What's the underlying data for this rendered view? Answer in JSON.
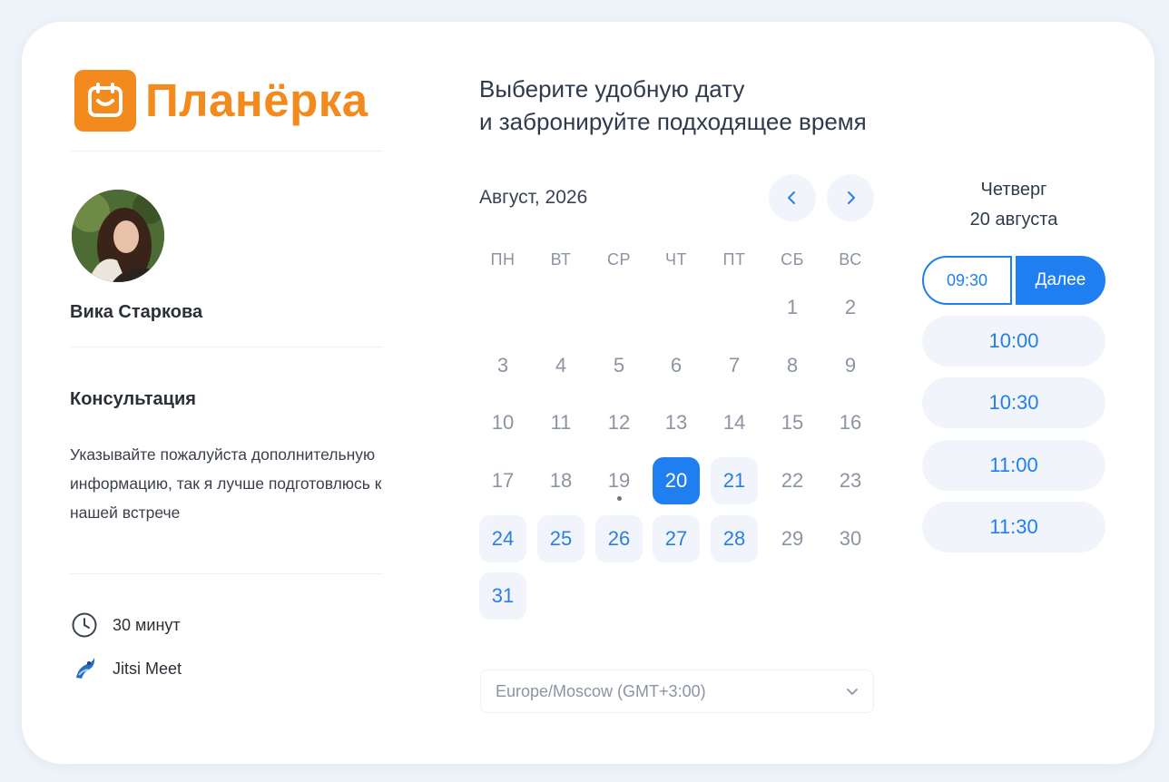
{
  "brand": {
    "name": "Планёрка",
    "color": "#f28a1d"
  },
  "host": {
    "name": "Вика Старкова"
  },
  "event": {
    "title": "Консультация",
    "description": "Указывайте пожалуйста дополнительную информацию, так я лучше подготовлюсь к нашей встрече",
    "duration": "30 минут",
    "location": "Jitsi Meet"
  },
  "heading": {
    "line1": "Выберите удобную дату",
    "line2": "и забронируйте подходящее время"
  },
  "calendar": {
    "month_label": "Август, 2026",
    "weekdays": [
      "ПН",
      "ВТ",
      "СР",
      "ЧТ",
      "ПТ",
      "СБ",
      "ВС"
    ],
    "first_weekday_index": 5,
    "days_in_month": 31,
    "today": 19,
    "selected": 20,
    "available": [
      20,
      21,
      24,
      25,
      26,
      27,
      28,
      31
    ]
  },
  "timezone": {
    "value": "Europe/Moscow (GMT+3:00)"
  },
  "slots": {
    "day_name": "Четверг",
    "day_date": "20 августа",
    "selected_time": "09:30",
    "next_label": "Далее",
    "times": [
      "10:00",
      "10:30",
      "11:00",
      "11:30"
    ]
  },
  "colors": {
    "accent": "#1f7ff0",
    "muted": "#8c93a3",
    "available_bg": "#f1f5fb"
  }
}
